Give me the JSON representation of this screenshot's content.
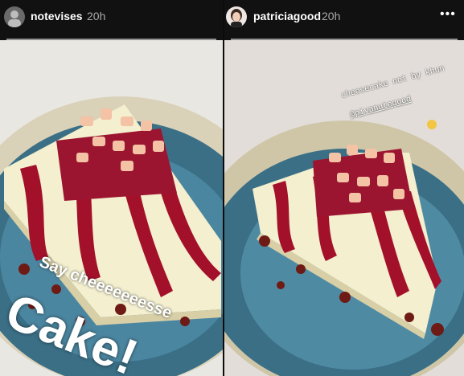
{
  "stories": [
    {
      "username": "notevises",
      "time": "20h",
      "more_label": "",
      "captions": {
        "line1": "Say cheeeeeeesse",
        "line2": "Cake!"
      }
    },
    {
      "username": "patriciagood",
      "time": "20h",
      "more_label": "•••",
      "captions": {
        "line1": "cheesecake not by khun",
        "mention": "@piyanutegood",
        "emoji": "grimacing-face-emoji"
      }
    }
  ],
  "colors": {
    "header_bg": "#111111",
    "plate_blue": "#3a6f86",
    "sauce_red": "#a3102a",
    "cheesecake": "#f3efcf"
  }
}
